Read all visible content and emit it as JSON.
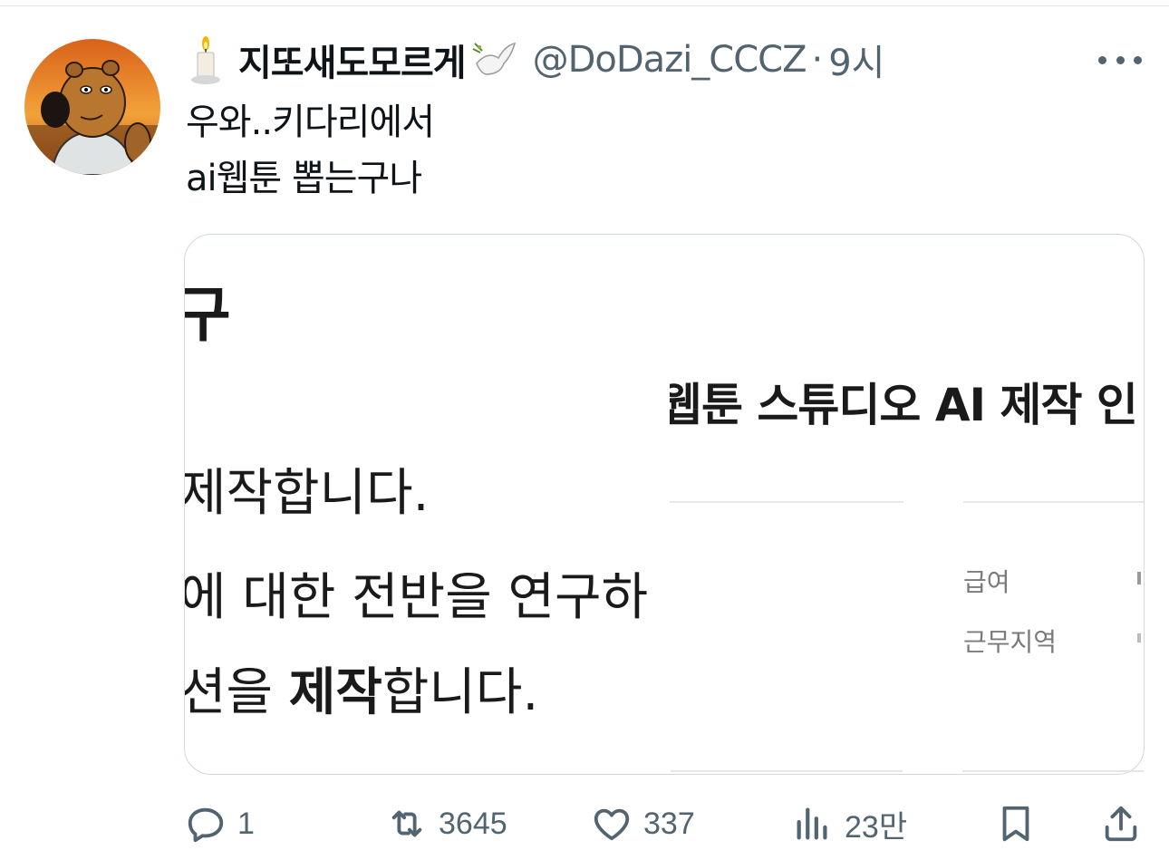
{
  "tweet": {
    "display_name": "지또새도모르게",
    "handle": "@DoDazi_CCCZ",
    "separator": "·",
    "time": "9시",
    "text_lines": [
      "우와..키다리에서",
      "ai웹툰 뽑는구나"
    ]
  },
  "media": {
    "left_panel": {
      "line1": "구",
      "line2": "제작합니다.",
      "line3": "에 대한 전반을 연구하",
      "line4_prefix": "션을 ",
      "line4_bold": "제작",
      "line4_suffix": "합니다."
    },
    "right_panel": {
      "title": "웹툰 스튜디오 AI 제작 인",
      "label_salary": "급여",
      "label_location": "근무지역"
    }
  },
  "actions": {
    "replies": "1",
    "retweets": "3645",
    "likes": "337",
    "views": "23만"
  },
  "colors": {
    "text": "#0f1419",
    "secondary": "#536471",
    "border": "#cfd9de"
  },
  "icons": [
    "candle-icon",
    "dove-icon",
    "more-icon",
    "reply-icon",
    "retweet-icon",
    "like-icon",
    "views-icon",
    "bookmark-icon",
    "share-icon"
  ]
}
